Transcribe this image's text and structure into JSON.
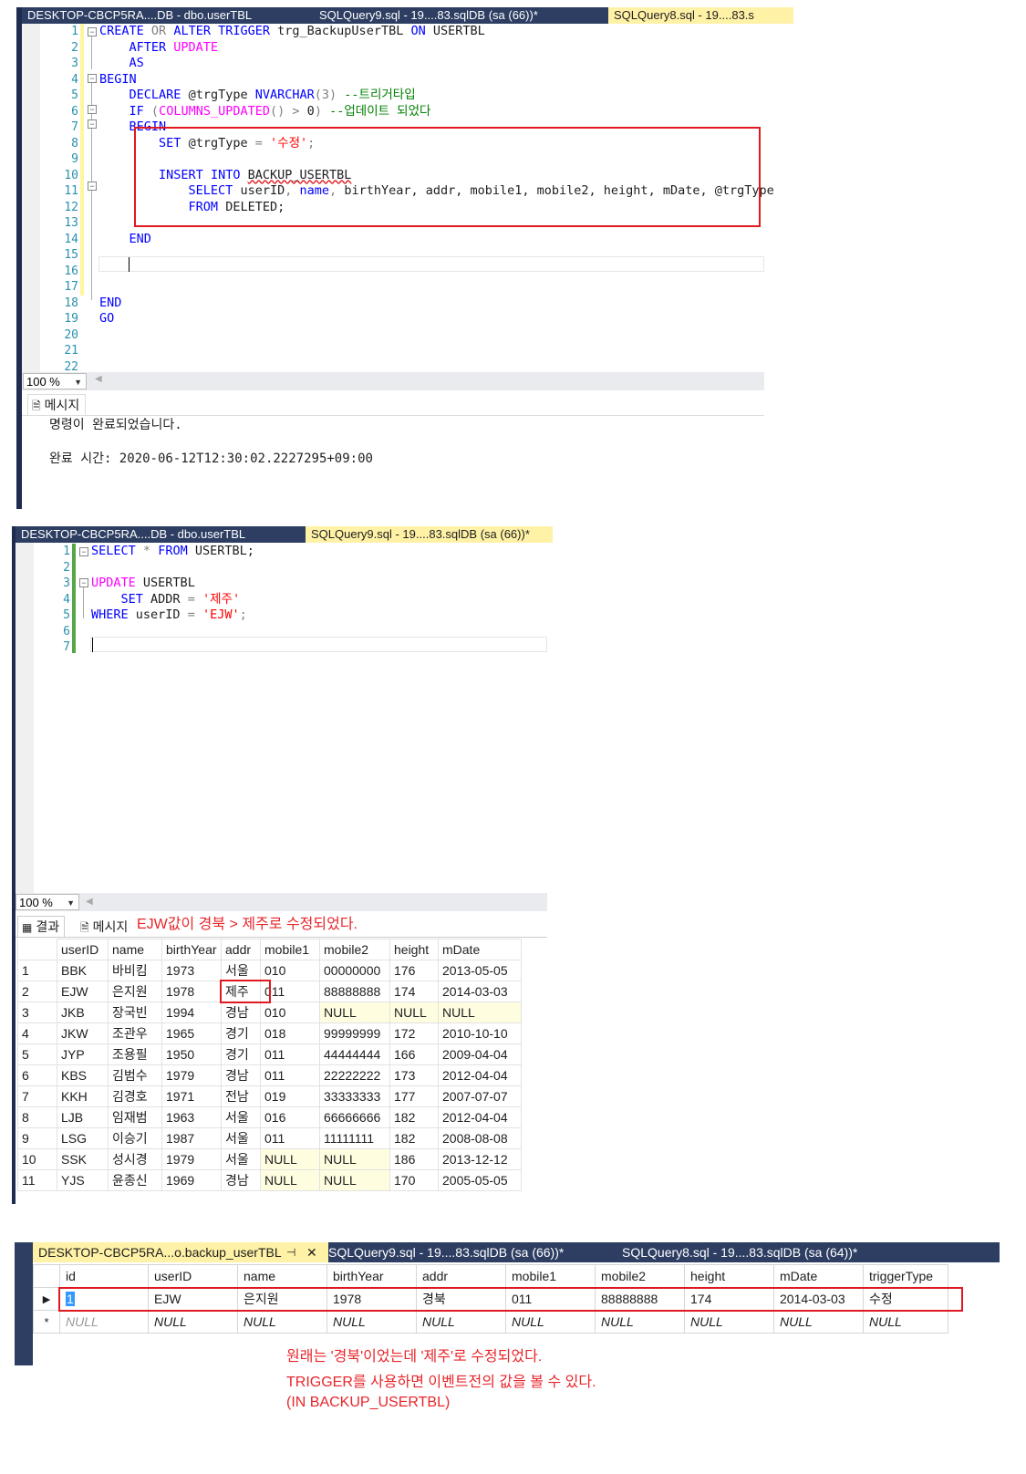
{
  "panel1": {
    "tabs": [
      "DESKTOP-CBCP5RA....DB - dbo.userTBL",
      "SQLQuery9.sql - 19....83.sqlDB (sa (66))*",
      "SQLQuery8.sql - 19....83.s"
    ],
    "line_numbers": [
      "1",
      "2",
      "3",
      "4",
      "5",
      "6",
      "7",
      "8",
      "9",
      "10",
      "11",
      "12",
      "13",
      "14",
      "15",
      "16",
      "17",
      "18",
      "19",
      "20",
      "21",
      "22"
    ],
    "code": {
      "l1": {
        "create": "CREATE",
        "or": "OR",
        "alter": "ALTER",
        "trigger": "TRIGGER",
        "name": "trg_BackupUserTBL",
        "on": "ON",
        "table": "USERTBL"
      },
      "l2": {
        "after": "AFTER",
        "update": "UPDATE"
      },
      "l3": "AS",
      "l4": "BEGIN",
      "l5": {
        "declare": "DECLARE",
        "var": "@trgType",
        "type": "NVARCHAR",
        "len": "(3)",
        "comment": "--트리거타입"
      },
      "l6": {
        "if": "IF",
        "open": "(",
        "fn": "COLUMNS_UPDATED",
        "fnargs": "()",
        "gt": ">",
        "zero": "0",
        "close": ")",
        "comment": "--업데이트 되었다"
      },
      "l7": "BEGIN",
      "l8": {
        "set": "SET",
        "var": "@trgType",
        "eq": "=",
        "val": "'수정'",
        "semi": ";"
      },
      "l10": {
        "insert": "INSERT",
        "into": "INTO",
        "table": "BACKUP_USERTBL"
      },
      "l11": {
        "select": "SELECT",
        "c1": "userID",
        "name": "name",
        "rest": "birthYear, addr, mobile1, mobile2, height, mDate, @trgType"
      },
      "l12": {
        "from": "FROM",
        "table": "DELETED;"
      },
      "l14": "END",
      "l18": "END",
      "l19": "GO"
    },
    "zoom": "100 %",
    "messages_tab": "메시지",
    "message_line1": "명령이 완료되었습니다.",
    "message_line2": "완료 시간: 2020-06-12T12:30:02.2227295+09:00"
  },
  "panel2": {
    "tabs": [
      "DESKTOP-CBCP5RA....DB - dbo.userTBL",
      "SQLQuery9.sql - 19....83.sqlDB (sa (66))*"
    ],
    "line_numbers": [
      "1",
      "2",
      "3",
      "4",
      "5",
      "6",
      "7"
    ],
    "code": {
      "l1": {
        "select": "SELECT",
        "star": "*",
        "from": "FROM",
        "table": "USERTBL;"
      },
      "l3": {
        "update": "UPDATE",
        "table": "USERTBL"
      },
      "l4": {
        "set": "SET",
        "col": "ADDR",
        "eq": "=",
        "val": "'제주'"
      },
      "l5": {
        "where": "WHERE",
        "col": "userID",
        "eq": "=",
        "val": "'EJW'",
        "semi": ";"
      }
    },
    "zoom": "100 %",
    "results_tab": "결과",
    "messages_tab": "메시지",
    "annotation": "EJW값이 경북 > 제주로 수정되었다.",
    "columns": [
      "",
      "userID",
      "name",
      "birthYear",
      "addr",
      "mobile1",
      "mobile2",
      "height",
      "mDate"
    ],
    "rows": [
      [
        "1",
        "BBK",
        "바비킴",
        "1973",
        "서울",
        "010",
        "00000000",
        "176",
        "2013-05-05"
      ],
      [
        "2",
        "EJW",
        "은지원",
        "1978",
        "제주",
        "011",
        "88888888",
        "174",
        "2014-03-03"
      ],
      [
        "3",
        "JKB",
        "장국빈",
        "1994",
        "경남",
        "010",
        "NULL",
        "NULL",
        "NULL"
      ],
      [
        "4",
        "JKW",
        "조관우",
        "1965",
        "경기",
        "018",
        "99999999",
        "172",
        "2010-10-10"
      ],
      [
        "5",
        "JYP",
        "조용필",
        "1950",
        "경기",
        "011",
        "44444444",
        "166",
        "2009-04-04"
      ],
      [
        "6",
        "KBS",
        "김범수",
        "1979",
        "경남",
        "011",
        "22222222",
        "173",
        "2012-04-04"
      ],
      [
        "7",
        "KKH",
        "김경호",
        "1971",
        "전남",
        "019",
        "33333333",
        "177",
        "2007-07-07"
      ],
      [
        "8",
        "LJB",
        "임재범",
        "1963",
        "서울",
        "016",
        "66666666",
        "182",
        "2012-04-04"
      ],
      [
        "9",
        "LSG",
        "이승기",
        "1987",
        "서울",
        "011",
        "11111111",
        "182",
        "2008-08-08"
      ],
      [
        "10",
        "SSK",
        "성시경",
        "1979",
        "서울",
        "NULL",
        "NULL",
        "186",
        "2013-12-12"
      ],
      [
        "11",
        "YJS",
        "윤종신",
        "1969",
        "경남",
        "NULL",
        "NULL",
        "170",
        "2005-05-05"
      ]
    ]
  },
  "panel3": {
    "tabs": [
      "DESKTOP-CBCP5RA...o.backup_userTBL",
      "SQLQuery9.sql - 19....83.sqlDB (sa (66))*",
      "SQLQuery8.sql - 19....83.sqlDB (sa (64))*"
    ],
    "pin_icon": "pin-icon",
    "close_icon": "close-icon",
    "columns": [
      "id",
      "userID",
      "name",
      "birthYear",
      "addr",
      "mobile1",
      "mobile2",
      "height",
      "mDate",
      "triggerType"
    ],
    "row": [
      "1",
      "EJW",
      "은지원",
      "1978",
      "경북",
      "011",
      "88888888",
      "174",
      "2014-03-03",
      "수정"
    ],
    "new_row": [
      "NULL",
      "NULL",
      "NULL",
      "NULL",
      "NULL",
      "NULL",
      "NULL",
      "NULL",
      "NULL",
      "NULL"
    ],
    "row_marker": "▶",
    "new_row_marker": "*",
    "note1": "원래는 '경북'이었는데 '제주'로 수정되었다.",
    "note2": "TRIGGER를 사용하면 이벤트전의 값을 볼 수 있다.",
    "note3": "(IN BACKUP_USERTBL)"
  },
  "colors": {
    "keyword": "#0000ff",
    "function": "#ff00ff",
    "string": "#ff0000",
    "comment": "#008000",
    "annotation": "#e8262b",
    "tab_active": "#fff1a6",
    "tab_bar": "#2d3e62"
  }
}
